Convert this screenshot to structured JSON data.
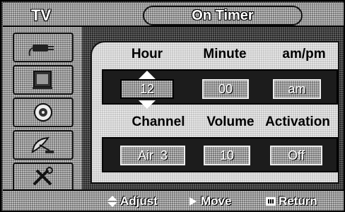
{
  "menu": {
    "section": "TV",
    "title": "On Timer"
  },
  "sidebar": {
    "icons": [
      "input-icon",
      "picture-icon",
      "sound-icon",
      "channel-icon",
      "setup-icon"
    ]
  },
  "timer": {
    "headers": {
      "hour": "Hour",
      "minute": "Minute",
      "ampm": "am/pm"
    },
    "values": {
      "hour": "12",
      "minute": "00",
      "ampm": "am"
    },
    "selected_field": "hour"
  },
  "channel_settings": {
    "headers": {
      "channel": "Channel",
      "volume": "Volume",
      "activation": "Activation"
    },
    "values": {
      "channel": "Air  3",
      "volume": "10",
      "activation": "Off"
    }
  },
  "hints": {
    "adjust": "Adjust",
    "move": "Move",
    "return": "Return"
  }
}
